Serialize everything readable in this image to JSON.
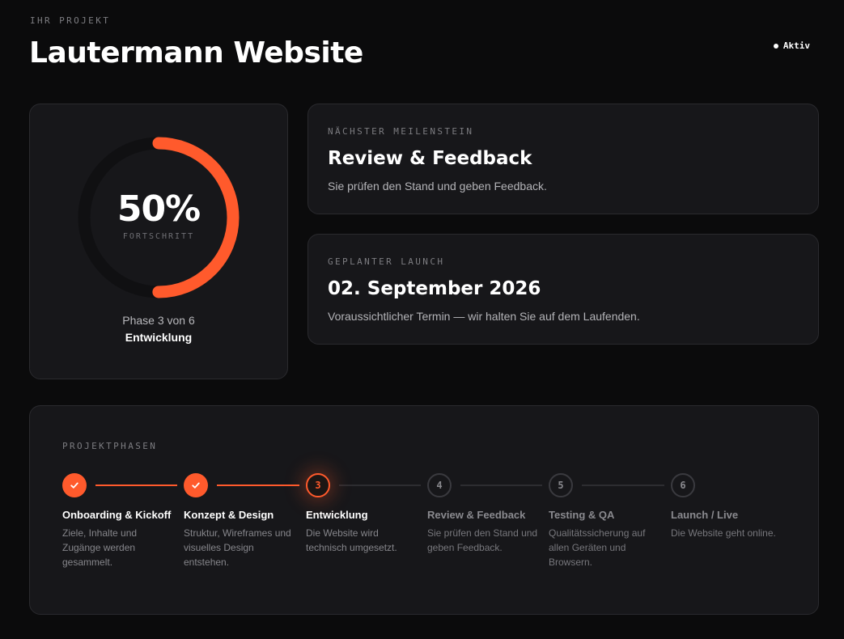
{
  "header": {
    "eyebrow": "IHR PROJEKT",
    "title": "Lautermann Website",
    "status": "Aktiv"
  },
  "progress": {
    "value": 50,
    "value_label": "50%",
    "label": "FORTSCHRITT",
    "phase_text": "Phase 3 von 6",
    "phase_name": "Entwicklung"
  },
  "milestone": {
    "eyebrow": "NÄCHSTER MEILENSTEIN",
    "title": "Review & Feedback",
    "description": "Sie prüfen den Stand und geben Feedback."
  },
  "launch": {
    "eyebrow": "GEPLANTER LAUNCH",
    "title": "02. September 2026",
    "description": "Voraussichtlicher Termin — wir halten Sie auf dem Laufenden."
  },
  "phases": {
    "eyebrow": "PROJEKTPHASEN",
    "items": [
      {
        "number": "1",
        "state": "done",
        "name": "Onboarding & Kickoff",
        "description": "Ziele, Inhalte und Zugänge werden gesammelt."
      },
      {
        "number": "2",
        "state": "done",
        "name": "Konzept & Design",
        "description": "Struktur, Wireframes und visuelles Design entstehen."
      },
      {
        "number": "3",
        "state": "current",
        "name": "Entwicklung",
        "description": "Die Website wird technisch umgesetzt."
      },
      {
        "number": "4",
        "state": "todo",
        "name": "Review & Feedback",
        "description": "Sie prüfen den Stand und geben Feedback."
      },
      {
        "number": "5",
        "state": "todo",
        "name": "Testing & QA",
        "description": "Qualitätssicherung auf allen Geräten und Browsern."
      },
      {
        "number": "6",
        "state": "todo",
        "name": "Launch / Live",
        "description": "Die Website geht online."
      }
    ]
  },
  "colors": {
    "accent": "#ff5a2c",
    "background": "#0b0b0c",
    "card": "#17171a"
  },
  "icons": {
    "check": "check-icon",
    "status_dot": "status-dot-icon"
  }
}
